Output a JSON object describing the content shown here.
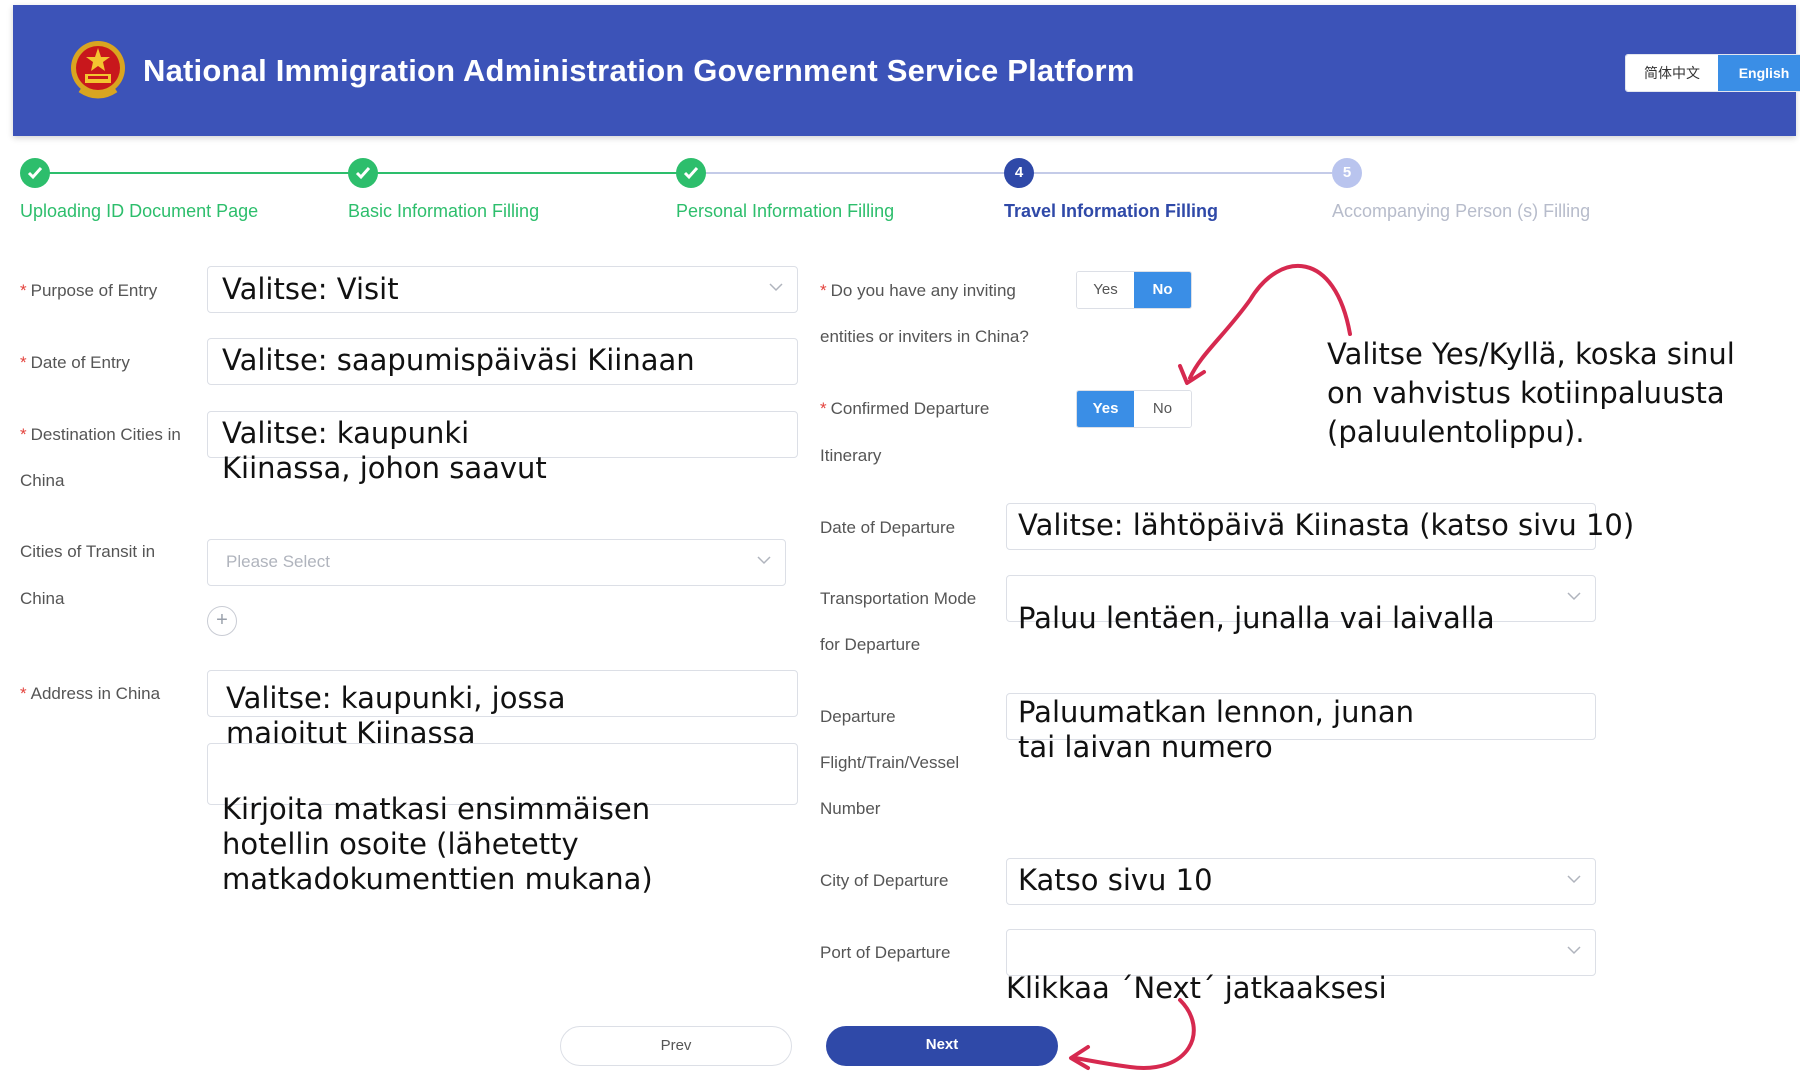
{
  "header": {
    "title": "National Immigration Administration Government Service Platform",
    "lang_zh": "简体中文",
    "lang_en": "English"
  },
  "steps": [
    {
      "label": "Uploading ID Document Page",
      "state": "done"
    },
    {
      "label": "Basic Information Filling",
      "state": "done"
    },
    {
      "label": "Personal Information Filling",
      "state": "done"
    },
    {
      "label": "Travel Information Filling",
      "state": "active",
      "number": "4"
    },
    {
      "label": "Accompanying Person (s) Filling",
      "state": "pending",
      "number": "5"
    }
  ],
  "left_form": {
    "purpose_label": "Purpose of Entry",
    "purpose_value": "Valitse: Visit",
    "date_entry_label": "Date of Entry",
    "date_entry_value": "Valitse: saapumispäiväsi Kiinaan",
    "dest_label_1": "Destination Cities in",
    "dest_label_2": "China",
    "dest_value_1": "Valitse: kaupunki",
    "dest_value_2": "Kiinassa, johon saavut",
    "transit_label_1": "Cities of Transit in",
    "transit_label_2": "China",
    "transit_placeholder": "Please Select",
    "add_symbol": "+",
    "address_label": "Address in China",
    "address_value_1": "Valitse: kaupunki, jossa",
    "address_value_2": "majoitut Kiinassa",
    "hotel_note_1": "Kirjoita matkasi ensimmäisen",
    "hotel_note_2": "hotellin osoite (lähetetty",
    "hotel_note_3": "matkadokumenttien mukana)"
  },
  "right_form": {
    "inviting_label_1": "Do you have any inviting",
    "inviting_label_2": "entities or inviters in China?",
    "inviting_yes": "Yes",
    "inviting_no": "No",
    "confirmed_label_1": "Confirmed Departure",
    "confirmed_label_2": "Itinerary",
    "confirmed_yes": "Yes",
    "confirmed_no": "No",
    "date_dep_label": "Date of Departure",
    "date_dep_value": "Valitse: lähtöpäivä Kiinasta (katso sivu 10)",
    "transport_label_1": "Transportation Mode",
    "transport_label_2": "for Departure",
    "transport_value": "Paluu lentäen, junalla vai laivalla",
    "flight_label_1": "Departure",
    "flight_label_2": "Flight/Train/Vessel",
    "flight_label_3": "Number",
    "flight_value_1": "Paluumatkan lennon, junan",
    "flight_value_2": "tai laivan numero",
    "city_dep_label": "City of Departure",
    "city_dep_value": "Katso sivu 10",
    "port_dep_label": "Port of Departure"
  },
  "annotations": {
    "yes_note_1": "Valitse Yes/Kyllä, koska sinul",
    "yes_note_2": "on vahvistus kotiinpaluusta",
    "yes_note_3": "(paluulentolippu).",
    "next_note": "Klikkaa ´Next´ jatkaaksesi"
  },
  "buttons": {
    "prev": "Prev",
    "next": "Next"
  },
  "colors": {
    "header": "#3c53b8",
    "done": "#2dbe6c",
    "active": "#2f49a8",
    "toggle_on": "#3a8ee6",
    "arrow": "#d6294f"
  }
}
